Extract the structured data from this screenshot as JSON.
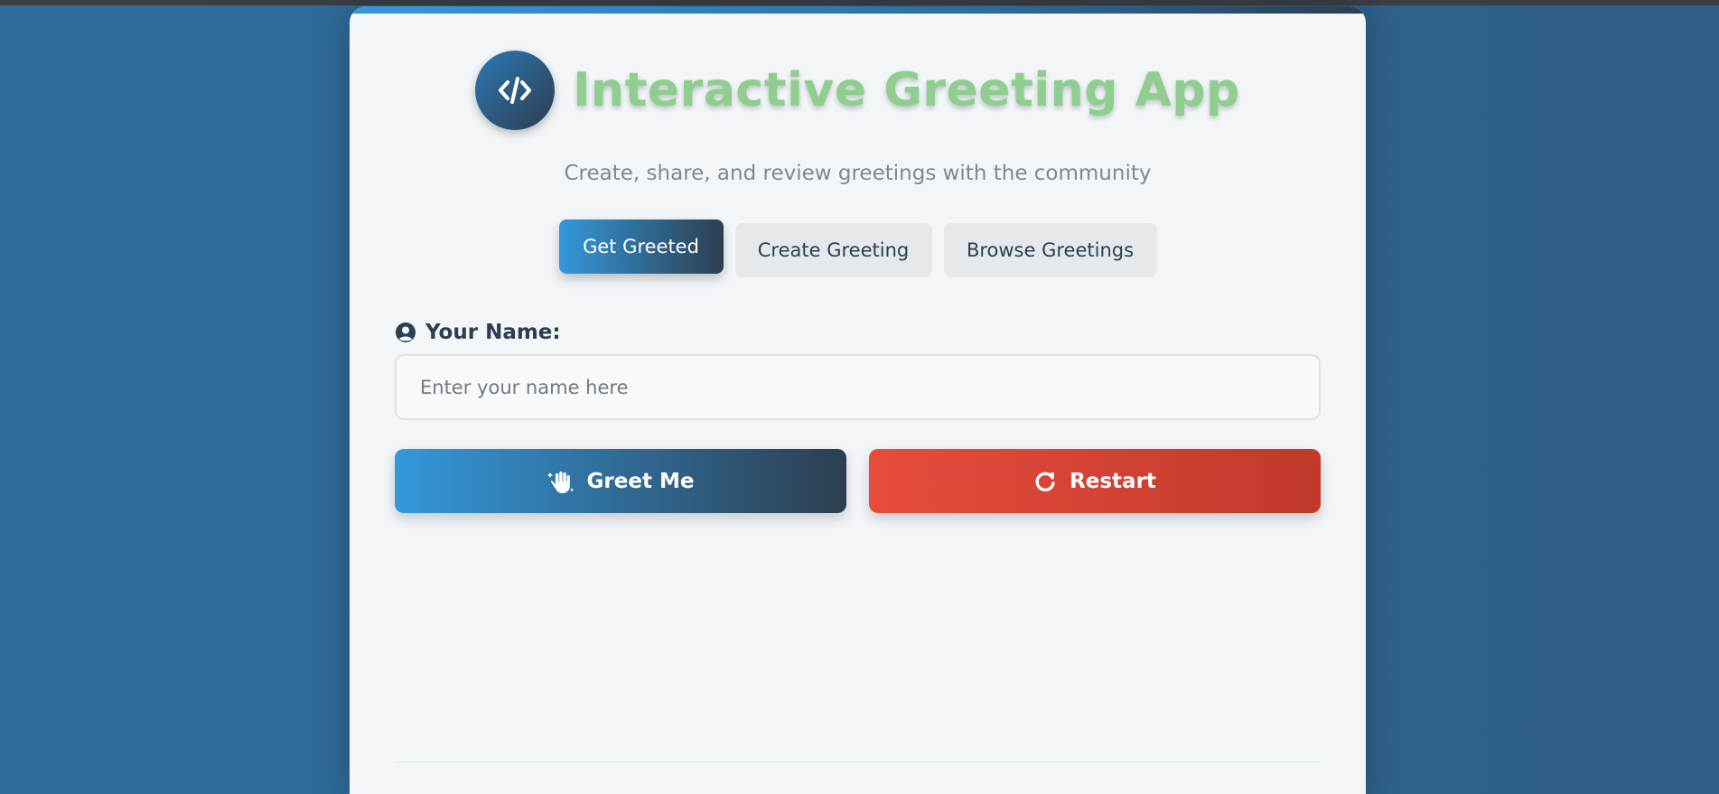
{
  "app": {
    "title": "Interactive Greeting App",
    "subtitle": "Create, share, and review greetings with the community",
    "logo_icon": "code-icon"
  },
  "tabs": [
    {
      "label": "Get Greeted",
      "active": true
    },
    {
      "label": "Create Greeting",
      "active": false
    },
    {
      "label": "Browse Greetings",
      "active": false
    }
  ],
  "form": {
    "name_label": "Your Name:",
    "name_icon": "user-circle-icon",
    "name_value": "",
    "name_placeholder": "Enter your name here"
  },
  "actions": {
    "greet_label": "Greet Me",
    "greet_icon": "hand-wave-icon",
    "restart_label": "Restart",
    "restart_icon": "rotate-icon"
  },
  "colors": {
    "primary": "#3498db",
    "primary_dark": "#2c3e50",
    "danger": "#e74c3c",
    "danger_dark": "#c0392b",
    "title_green": "#8fce8e",
    "background": "#2f6694"
  }
}
